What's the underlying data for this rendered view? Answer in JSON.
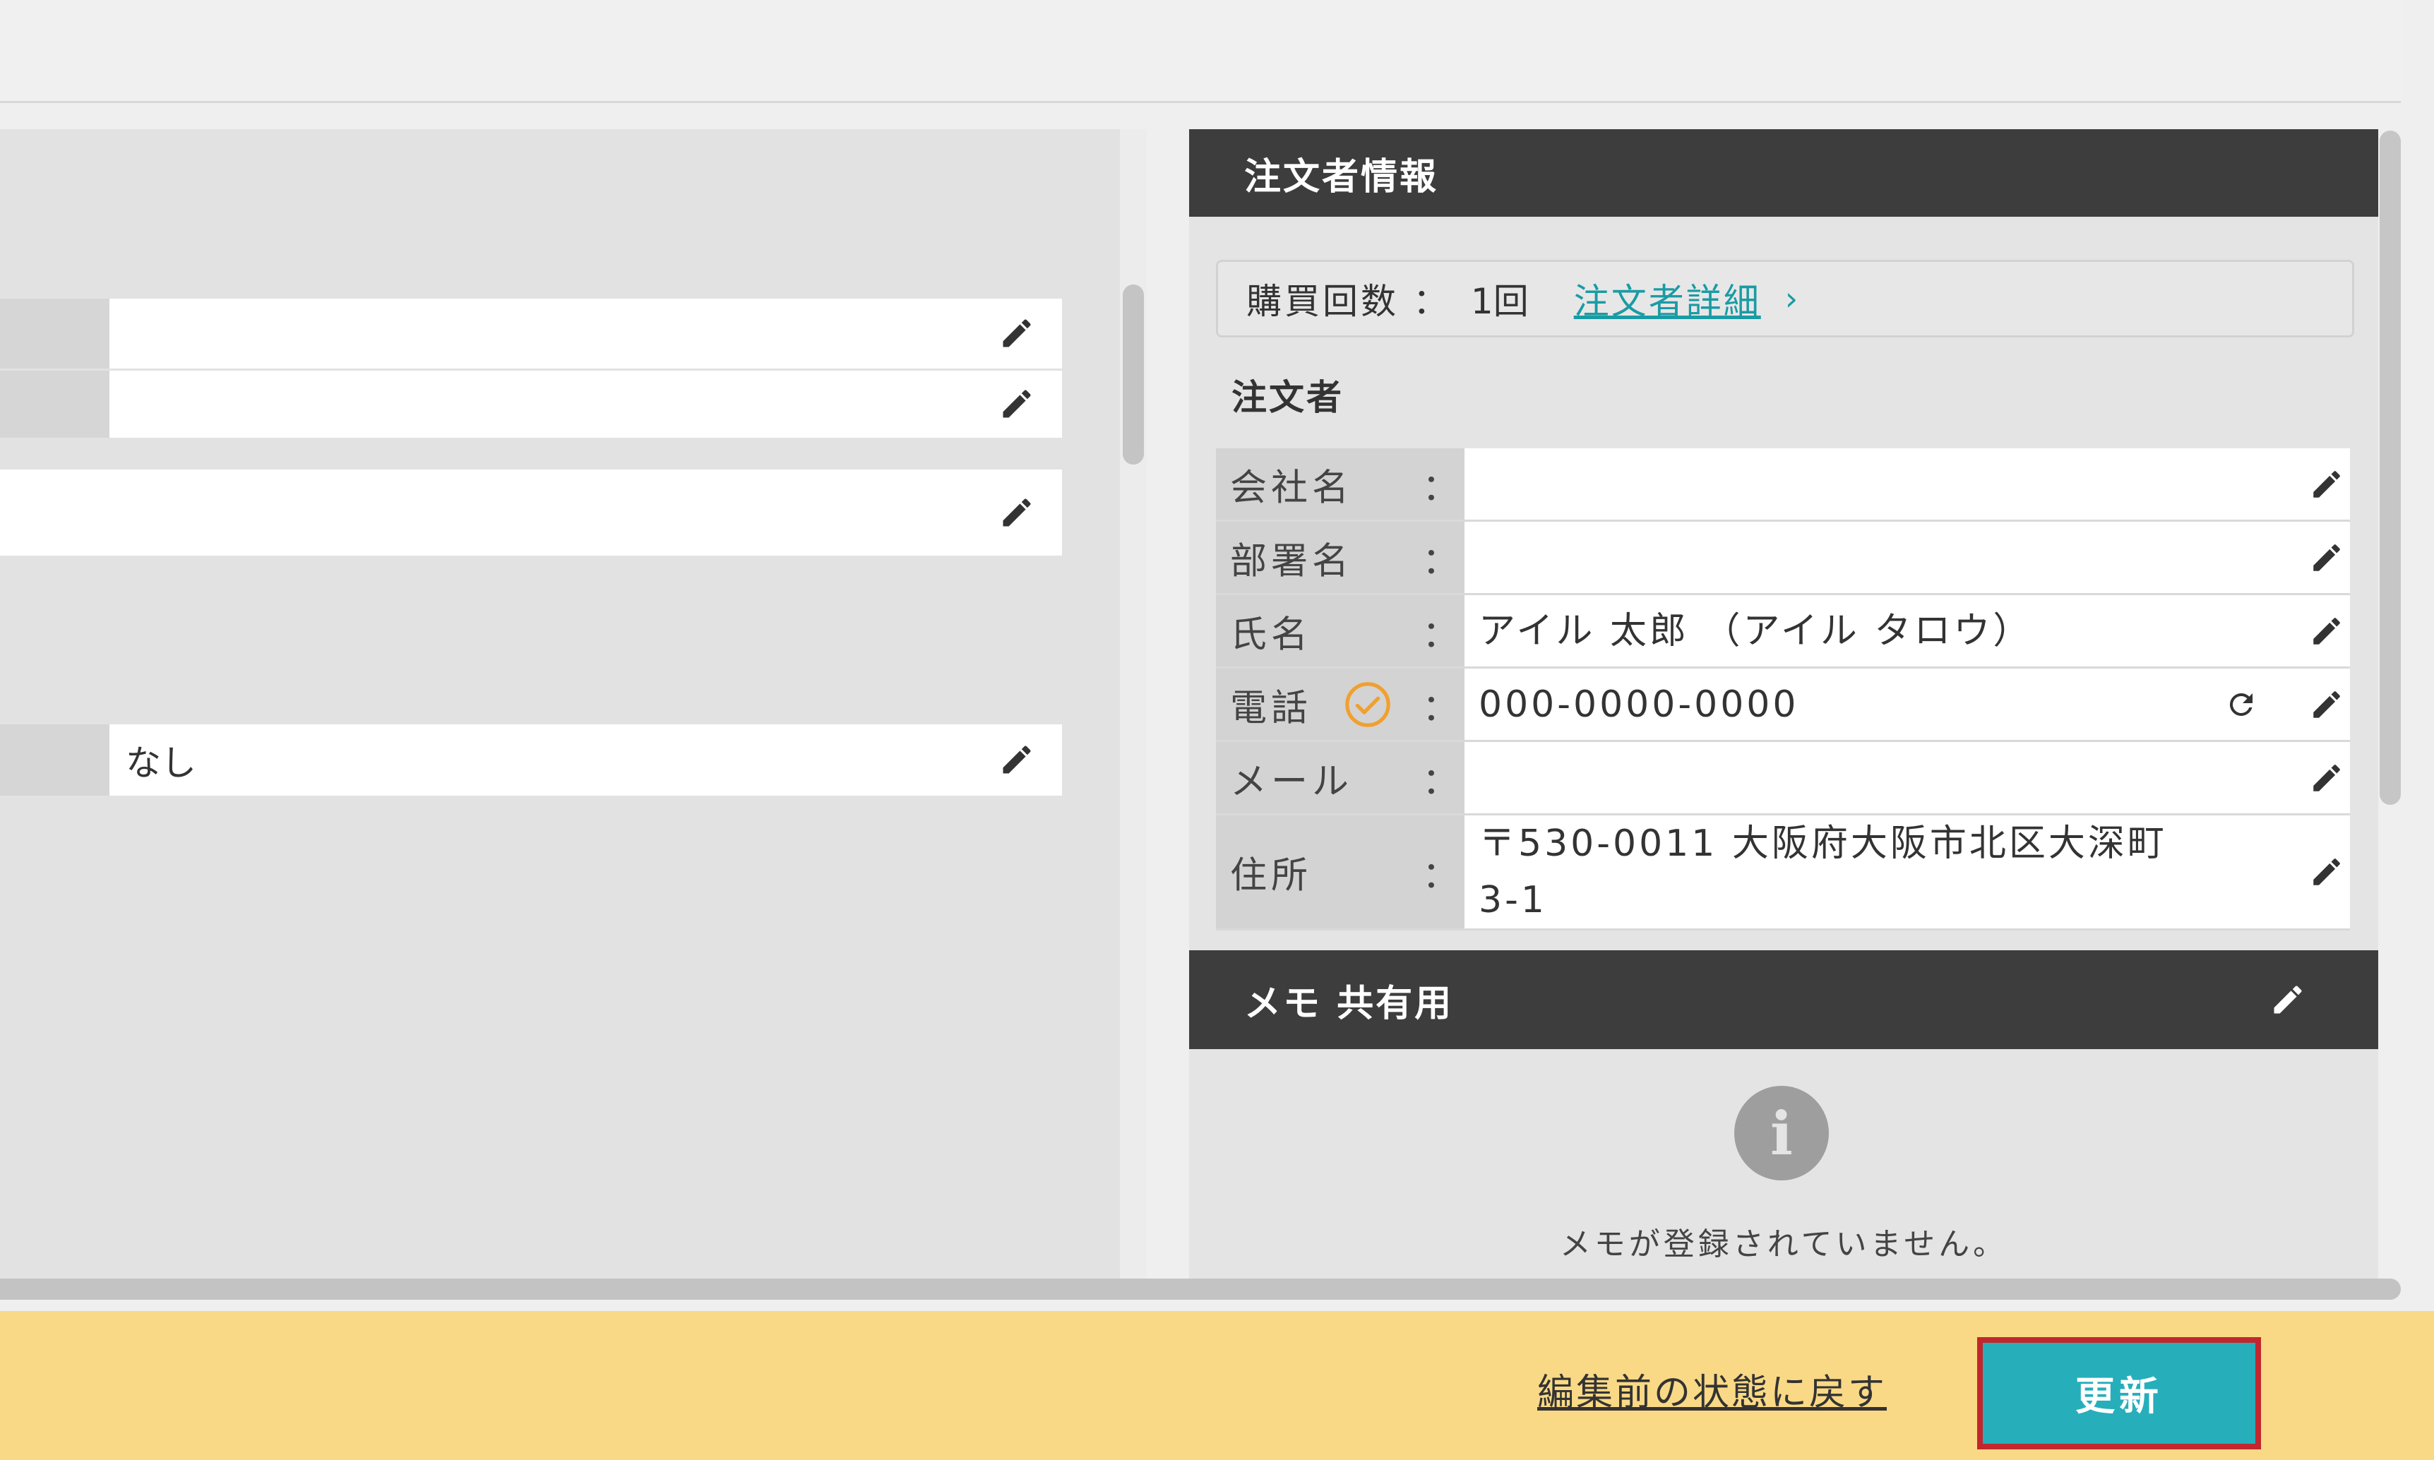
{
  "left_panel": {
    "rows": [
      {
        "value": ""
      },
      {
        "value": ""
      },
      {
        "value": ""
      },
      {
        "value": "なし"
      }
    ]
  },
  "orderer_panel": {
    "title": "注文者情報",
    "purchase": {
      "label": "購買回数 ：",
      "count": "1回",
      "detail_link": "注文者詳細",
      "chevron": "›"
    },
    "subtitle": "注文者",
    "fields": [
      {
        "label": "会社名",
        "colon": "：",
        "value": ""
      },
      {
        "label": "部署名",
        "colon": "：",
        "value": ""
      },
      {
        "label": "氏名",
        "colon": "：",
        "value": "アイル 太郎 （アイル タロウ）"
      },
      {
        "label": "電話",
        "colon": "：",
        "value": "000-0000-0000"
      },
      {
        "label": "メール",
        "colon": "：",
        "value": ""
      },
      {
        "label": "住所",
        "colon": "：",
        "value_line1": "〒530-0011 大阪府大阪市北区大深町",
        "value_line2": "3-1"
      }
    ]
  },
  "memo_panel": {
    "title": "メモ 共有用",
    "info_glyph": "i",
    "empty_message": "メモが登録されていません。"
  },
  "footer": {
    "revert_label": "編集前の状態に戻す",
    "update_label": "更新"
  },
  "colors": {
    "header_bg": "#3d3d3d",
    "link": "#1a9ba4",
    "check_orange": "#f0a030",
    "footer_bg": "#fad986",
    "button_bg": "#26aebb",
    "button_border": "#c1272d"
  },
  "icons": [
    "pencil-icon",
    "check-circle-icon",
    "refresh-icon",
    "info-icon",
    "chevron-right-icon"
  ]
}
